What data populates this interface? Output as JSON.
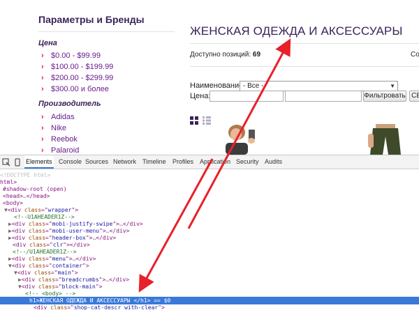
{
  "sidebar": {
    "title": "Параметры и Бренды",
    "price_heading": "Цена",
    "price_items": [
      "$0.00 - $99.99",
      "$100.00 - $199.99",
      "$200.00 - $299.99",
      "$300.00 и более"
    ],
    "brands_heading": "Производитель",
    "brand_items": [
      "Adidas",
      "Nike",
      "Reebok",
      "Palaroid"
    ],
    "bullet_icon": "chevron-right-icon",
    "accent_color": "#d61a5c"
  },
  "content": {
    "category_title": "ЖЕНСКАЯ ОДЕЖДА И АКСЕССУАРЫ",
    "available_label": "Доступно позиций:",
    "available_count": "69",
    "sort_label_cut": "Со",
    "filter": {
      "name_label": "Наименование:",
      "name_select_value": "- Все -",
      "price_label": "Цена:",
      "filter_button": "Фильтровать",
      "reset_button_cut": "СБ"
    },
    "view_icons": [
      "grid-view-icon",
      "list-view-icon"
    ]
  },
  "devtools": {
    "tabs": [
      "Elements",
      "Console",
      "Sources",
      "Network",
      "Timeline",
      "Profiles",
      "Application",
      "Security",
      "Audits"
    ],
    "active_tab": "Elements",
    "selection_color": "#3879d9",
    "lines": [
      {
        "tri": "",
        "parts": [
          [
            "doctype",
            "<!DOCTYPE html>"
          ]
        ]
      },
      {
        "tri": "",
        "parts": [
          [
            "tag",
            "html>"
          ]
        ]
      },
      {
        "tri": "",
        "parts": [
          [
            "tag",
            "#shadow-root (open)"
          ]
        ]
      },
      {
        "tri": "",
        "parts": [
          [
            "tag",
            "<head>"
          ],
          [
            "gray",
            "…"
          ],
          [
            "tag",
            "</head>"
          ]
        ]
      },
      {
        "tri": "",
        "parts": [
          [
            "tag",
            "<body>"
          ]
        ]
      },
      {
        "tri": "▼",
        "parts": [
          [
            "tag",
            "<div "
          ],
          [
            "attr",
            "class"
          ],
          [
            "tag",
            "=\""
          ],
          [
            "val",
            "wrapper"
          ],
          [
            "tag",
            "\">"
          ]
        ]
      },
      {
        "tri": "",
        "parts": [
          [
            "comment",
            "<!--U1AHEADER1Z-->"
          ]
        ]
      },
      {
        "tri": "▶",
        "parts": [
          [
            "tag",
            "<div "
          ],
          [
            "attr",
            "class"
          ],
          [
            "tag",
            "=\""
          ],
          [
            "val",
            "mobi-justify-swipe"
          ],
          [
            "tag",
            "\">"
          ],
          [
            "gray",
            "…"
          ],
          [
            "tag",
            "</div>"
          ]
        ]
      },
      {
        "tri": "▶",
        "parts": [
          [
            "tag",
            "<div "
          ],
          [
            "attr",
            "class"
          ],
          [
            "tag",
            "=\""
          ],
          [
            "val",
            "mobi-user-menu"
          ],
          [
            "tag",
            "\">"
          ],
          [
            "gray",
            "…"
          ],
          [
            "tag",
            "</div>"
          ]
        ]
      },
      {
        "tri": "▶",
        "parts": [
          [
            "tag",
            "<div "
          ],
          [
            "attr",
            "class"
          ],
          [
            "tag",
            "=\""
          ],
          [
            "val",
            "header-box"
          ],
          [
            "tag",
            "\">"
          ],
          [
            "gray",
            "…"
          ],
          [
            "tag",
            "</div>"
          ]
        ]
      },
      {
        "tri": "",
        "parts": [
          [
            "tag",
            "<div "
          ],
          [
            "attr",
            "class"
          ],
          [
            "tag",
            "=\""
          ],
          [
            "val",
            "clr"
          ],
          [
            "tag",
            "\"></div>"
          ]
        ]
      },
      {
        "tri": "",
        "parts": [
          [
            "comment",
            "<!--/U1AHEADER1Z-->"
          ]
        ]
      },
      {
        "tri": "▶",
        "parts": [
          [
            "tag",
            "<div "
          ],
          [
            "attr",
            "class"
          ],
          [
            "tag",
            "=\""
          ],
          [
            "val",
            "menu"
          ],
          [
            "tag",
            "\">"
          ],
          [
            "gray",
            "…"
          ],
          [
            "tag",
            "</div>"
          ]
        ]
      },
      {
        "tri": "▼",
        "parts": [
          [
            "tag",
            "<div "
          ],
          [
            "attr",
            "class"
          ],
          [
            "tag",
            "=\""
          ],
          [
            "val",
            "container"
          ],
          [
            "tag",
            "\">"
          ]
        ]
      },
      {
        "tri": "▼",
        "parts": [
          [
            "tag",
            "<div "
          ],
          [
            "attr",
            "class"
          ],
          [
            "tag",
            "=\""
          ],
          [
            "val",
            "main"
          ],
          [
            "tag",
            "\">"
          ]
        ]
      },
      {
        "tri": "▶",
        "parts": [
          [
            "tag",
            "<div "
          ],
          [
            "attr",
            "class"
          ],
          [
            "tag",
            "=\""
          ],
          [
            "val",
            "breadcrumbs"
          ],
          [
            "tag",
            "\">"
          ],
          [
            "gray",
            "…"
          ],
          [
            "tag",
            "</div>"
          ]
        ]
      },
      {
        "tri": "▼",
        "parts": [
          [
            "tag",
            "<div "
          ],
          [
            "attr",
            "class"
          ],
          [
            "tag",
            "=\""
          ],
          [
            "val",
            "block-main"
          ],
          [
            "tag",
            "\">"
          ]
        ]
      },
      {
        "tri": "",
        "parts": [
          [
            "comment",
            "<!-- <body> -->"
          ]
        ]
      },
      {
        "tri": "",
        "sel": true,
        "parts": [
          [
            "tag",
            "h1>"
          ],
          [
            "text",
            "ЖЕНСКАЯ ОДЕЖДА И АКСЕССУАРЫ "
          ],
          [
            "tag",
            "</h1>"
          ],
          [
            "text",
            " == $0"
          ]
        ]
      },
      {
        "tri": "",
        "parts": [
          [
            "tag",
            "<div "
          ],
          [
            "attr",
            "class"
          ],
          [
            "tag",
            "=\""
          ],
          [
            "val",
            "shop-cat-descr with-clear"
          ],
          [
            "tag",
            "\">"
          ]
        ]
      }
    ]
  },
  "annotation": {
    "arrow_color": "#e8202a"
  }
}
